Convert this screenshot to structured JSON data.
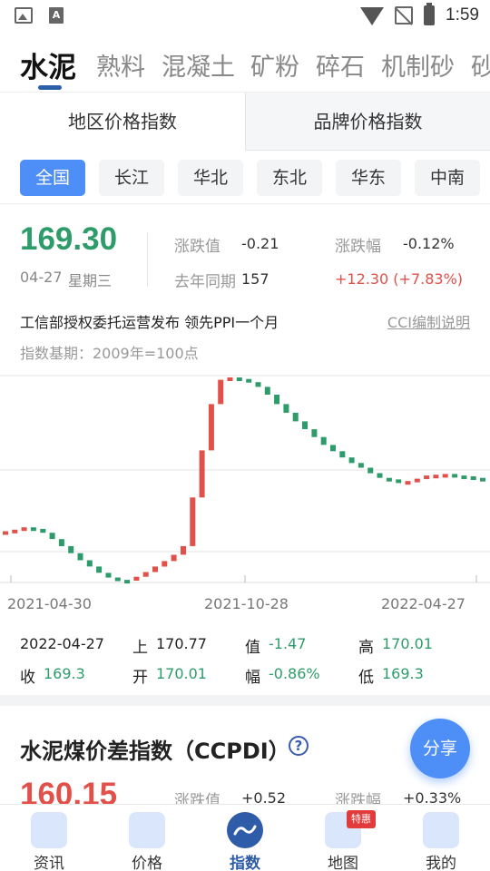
{
  "status_bar": {
    "time": "1:59"
  },
  "category_tabs": [
    "水泥",
    "熟料",
    "混凝土",
    "矿粉",
    "碎石",
    "机制砂",
    "砂"
  ],
  "index_tabs": [
    "地区价格指数",
    "品牌价格指数"
  ],
  "regions": [
    "全国",
    "长江",
    "华北",
    "东北",
    "华东",
    "中南"
  ],
  "price": {
    "value": "169.30",
    "date": "04-27",
    "weekday": "星期三",
    "change_label": "涨跌值",
    "change": "-0.21",
    "change_pct_label": "涨跌幅",
    "change_pct": "-0.12%",
    "last_year_label": "去年同期",
    "last_year": "157",
    "last_year_diff": "+12.30 (+7.83%)"
  },
  "news": {
    "headline": "工信部授权委托运营发布 领先PPI一个月",
    "link": "CCI编制说明",
    "base_note": "指数基期：2009年=100点"
  },
  "chart_data": {
    "type": "candlestick",
    "x_ticks": [
      "2021-04-30",
      "2021-10-28",
      "2022-04-27"
    ],
    "colors": {
      "up": "#e2504a",
      "down": "#2e9c6a"
    },
    "candles": [
      {
        "o": 150.0,
        "c": 150.2
      },
      {
        "o": 150.1,
        "c": 150.4
      },
      {
        "o": 150.4,
        "c": 150.7
      },
      {
        "o": 150.7,
        "c": 150.5
      },
      {
        "o": 150.5,
        "c": 150.0
      },
      {
        "o": 150.0,
        "c": 149.2
      },
      {
        "o": 149.2,
        "c": 148.3
      },
      {
        "o": 148.3,
        "c": 147.4
      },
      {
        "o": 147.4,
        "c": 146.5
      },
      {
        "o": 146.5,
        "c": 145.7
      },
      {
        "o": 145.7,
        "c": 144.9
      },
      {
        "o": 144.9,
        "c": 144.3
      },
      {
        "o": 144.3,
        "c": 144.0
      },
      {
        "o": 144.0,
        "c": 143.9
      },
      {
        "o": 143.9,
        "c": 144.4
      },
      {
        "o": 144.4,
        "c": 145.0
      },
      {
        "o": 145.0,
        "c": 145.7
      },
      {
        "o": 145.7,
        "c": 146.4
      },
      {
        "o": 146.4,
        "c": 147.2
      },
      {
        "o": 147.2,
        "c": 148.3
      },
      {
        "o": 148.3,
        "c": 154.5
      },
      {
        "o": 154.5,
        "c": 160.5
      },
      {
        "o": 160.5,
        "c": 166.4
      },
      {
        "o": 166.4,
        "c": 169.5
      },
      {
        "o": 169.5,
        "c": 169.8
      },
      {
        "o": 169.8,
        "c": 169.6
      },
      {
        "o": 169.6,
        "c": 169.2
      },
      {
        "o": 169.2,
        "c": 168.6
      },
      {
        "o": 168.6,
        "c": 167.6
      },
      {
        "o": 167.6,
        "c": 166.4
      },
      {
        "o": 166.4,
        "c": 165.3
      },
      {
        "o": 165.3,
        "c": 164.2
      },
      {
        "o": 164.2,
        "c": 163.2
      },
      {
        "o": 163.2,
        "c": 162.2
      },
      {
        "o": 162.2,
        "c": 161.2
      },
      {
        "o": 161.2,
        "c": 160.4
      },
      {
        "o": 160.4,
        "c": 159.6
      },
      {
        "o": 159.6,
        "c": 158.9
      },
      {
        "o": 158.9,
        "c": 158.3
      },
      {
        "o": 158.3,
        "c": 157.6
      },
      {
        "o": 157.6,
        "c": 157.0
      },
      {
        "o": 157.0,
        "c": 156.8
      },
      {
        "o": 156.8,
        "c": 156.6
      },
      {
        "o": 156.6,
        "c": 156.6
      },
      {
        "o": 156.6,
        "c": 156.9
      },
      {
        "o": 156.9,
        "c": 157.3
      },
      {
        "o": 157.3,
        "c": 157.4
      },
      {
        "o": 157.4,
        "c": 157.5
      },
      {
        "o": 157.5,
        "c": 157.3
      },
      {
        "o": 157.3,
        "c": 157.2
      },
      {
        "o": 157.2,
        "c": 157.0
      },
      {
        "o": 157.0,
        "c": 156.7
      }
    ]
  },
  "summary": {
    "date": "2022-04-27",
    "prev_label": "上",
    "prev": "170.77",
    "value_label": "值",
    "value": "-1.47",
    "high_label": "高",
    "high": "170.01",
    "close_label": "收",
    "close": "169.3",
    "open_label": "开",
    "open": "170.01",
    "amp_label": "幅",
    "amp": "-0.86%",
    "low_label": "低",
    "low": "169.3"
  },
  "section2": {
    "title": "水泥煤价差指数（CCPDI）",
    "price": "160.15",
    "change_label": "涨跌值",
    "change": "+0.52",
    "change_pct_label": "涨跌幅",
    "change_pct": "+0.33%"
  },
  "share": "分享",
  "bottom_nav": [
    {
      "label": "资讯",
      "icon": "news-icon"
    },
    {
      "label": "价格",
      "icon": "price-chart-icon"
    },
    {
      "label": "指数",
      "icon": "index-icon",
      "active": true
    },
    {
      "label": "地图",
      "icon": "map-icon",
      "badge": "特惠"
    },
    {
      "label": "我的",
      "icon": "profile-icon"
    }
  ]
}
